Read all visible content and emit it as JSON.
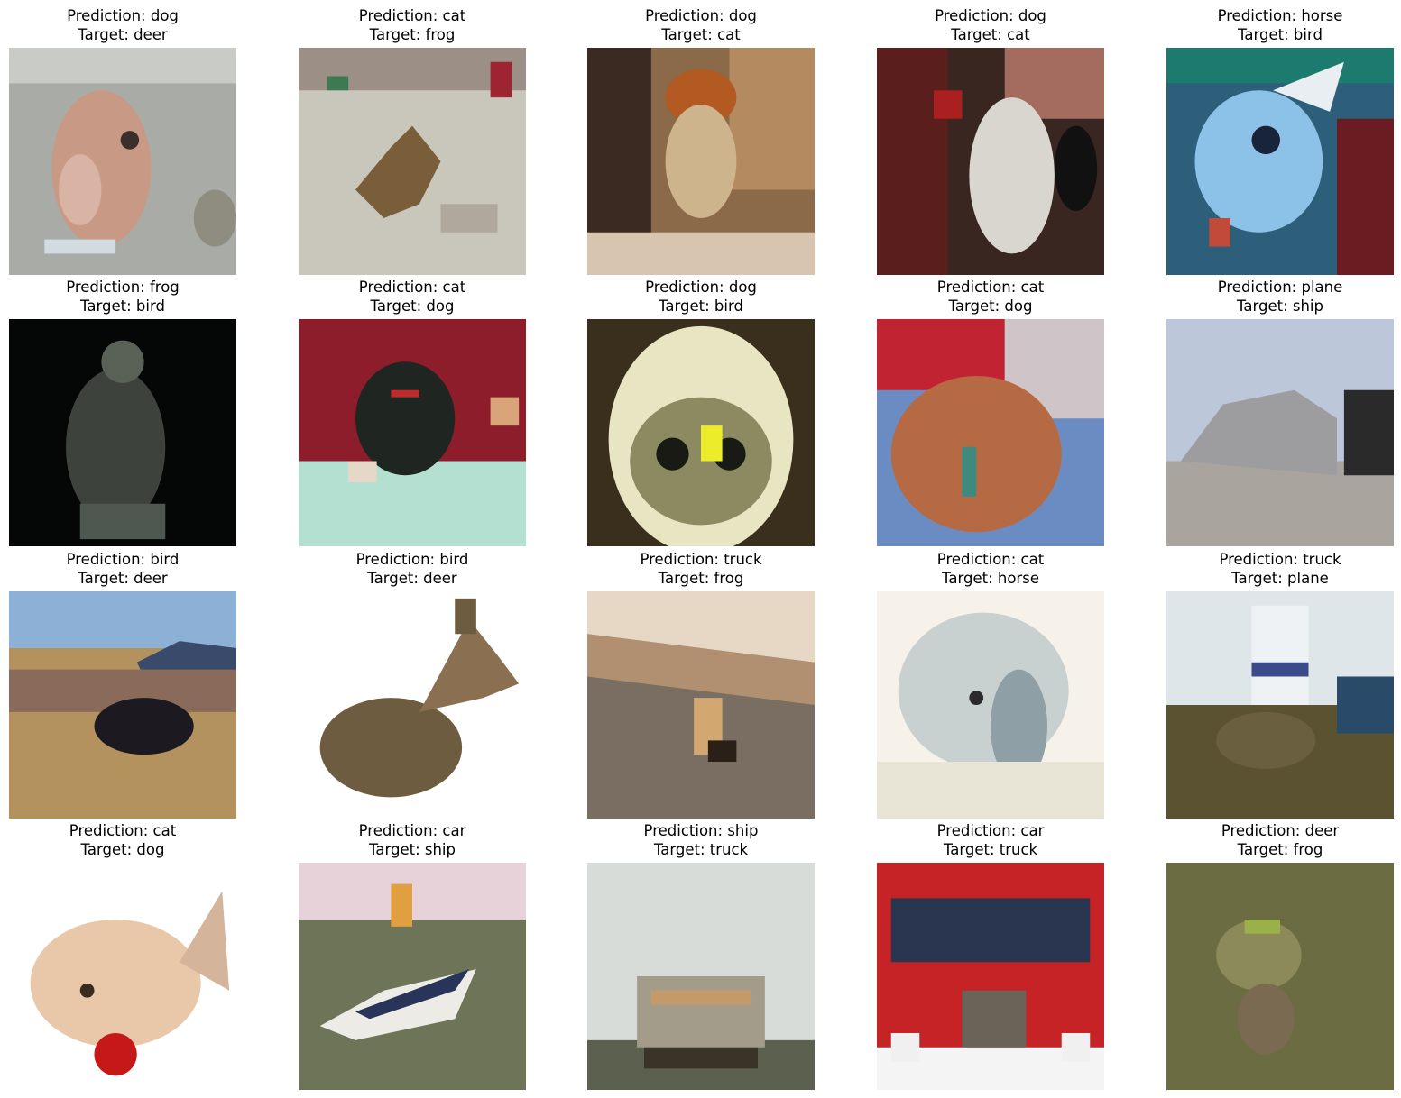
{
  "samples": [
    {
      "prediction": "Prediction: dog",
      "target": "Target: deer",
      "scene": "deer-closeup-grey"
    },
    {
      "prediction": "Prediction: cat",
      "target": "Target: frog",
      "scene": "frog-on-white"
    },
    {
      "prediction": "Prediction: dog",
      "target": "Target: cat",
      "scene": "cat-indoor"
    },
    {
      "prediction": "Prediction: dog",
      "target": "Target: cat",
      "scene": "black-white-cat"
    },
    {
      "prediction": "Prediction: horse",
      "target": "Target: bird",
      "scene": "blue-parrot"
    },
    {
      "prediction": "Prediction: frog",
      "target": "Target: bird",
      "scene": "hawk-dark"
    },
    {
      "prediction": "Prediction: cat",
      "target": "Target: dog",
      "scene": "black-puppy-red"
    },
    {
      "prediction": "Prediction: dog",
      "target": "Target: bird",
      "scene": "owl-face"
    },
    {
      "prediction": "Prediction: cat",
      "target": "Target: dog",
      "scene": "brown-dog-red"
    },
    {
      "prediction": "Prediction: plane",
      "target": "Target: ship",
      "scene": "grey-ship"
    },
    {
      "prediction": "Prediction: bird",
      "target": "Target: deer",
      "scene": "dark-animal-field"
    },
    {
      "prediction": "Prediction: bird",
      "target": "Target: deer",
      "scene": "deer-on-white"
    },
    {
      "prediction": "Prediction: truck",
      "target": "Target: frog",
      "scene": "frog-diagonal"
    },
    {
      "prediction": "Prediction: cat",
      "target": "Target: horse",
      "scene": "white-horse"
    },
    {
      "prediction": "Prediction: truck",
      "target": "Target: plane",
      "scene": "plane-tail-yard"
    },
    {
      "prediction": "Prediction: cat",
      "target": "Target: dog",
      "scene": "puppy-red-ball"
    },
    {
      "prediction": "Prediction: car",
      "target": "Target: ship",
      "scene": "rowboat-grass"
    },
    {
      "prediction": "Prediction: ship",
      "target": "Target: truck",
      "scene": "truck-rear-grey"
    },
    {
      "prediction": "Prediction: car",
      "target": "Target: truck",
      "scene": "red-fire-truck"
    },
    {
      "prediction": "Prediction: deer",
      "target": "Target: frog",
      "scene": "green-frog-murky"
    }
  ]
}
